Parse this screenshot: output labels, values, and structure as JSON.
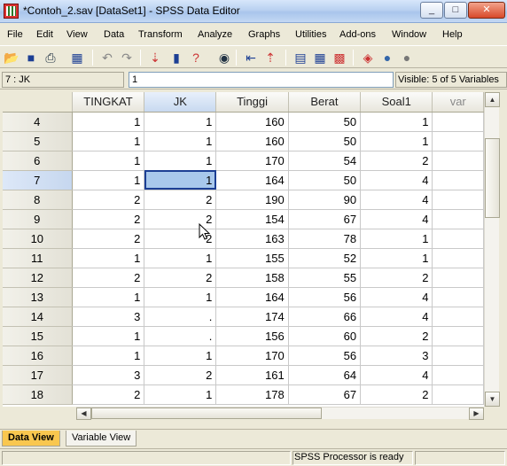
{
  "window": {
    "title": "*Contoh_2.sav [DataSet1] - SPSS Data Editor",
    "minimize": "_",
    "maximize": "□",
    "close": "✕"
  },
  "menu": [
    "File",
    "Edit",
    "View",
    "Data",
    "Transform",
    "Analyze",
    "Graphs",
    "Utilities",
    "Add-ons",
    "Window",
    "Help"
  ],
  "cellbar": {
    "ref": "7 : JK",
    "value": "1",
    "visible": "Visible: 5 of 5 Variables"
  },
  "grid": {
    "columns": [
      "TINGKAT",
      "JK",
      "Tinggi",
      "Berat",
      "Soal1",
      "var"
    ],
    "rows": [
      {
        "n": "4",
        "cells": [
          "1",
          "1",
          "160",
          "50",
          "1"
        ]
      },
      {
        "n": "5",
        "cells": [
          "1",
          "1",
          "160",
          "50",
          "1"
        ]
      },
      {
        "n": "6",
        "cells": [
          "1",
          "1",
          "170",
          "54",
          "2"
        ]
      },
      {
        "n": "7",
        "cells": [
          "1",
          "1",
          "164",
          "50",
          "4"
        ]
      },
      {
        "n": "8",
        "cells": [
          "2",
          "2",
          "190",
          "90",
          "4"
        ]
      },
      {
        "n": "9",
        "cells": [
          "2",
          "2",
          "154",
          "67",
          "4"
        ]
      },
      {
        "n": "10",
        "cells": [
          "2",
          "2",
          "163",
          "78",
          "1"
        ]
      },
      {
        "n": "11",
        "cells": [
          "1",
          "1",
          "155",
          "52",
          "1"
        ]
      },
      {
        "n": "12",
        "cells": [
          "2",
          "2",
          "158",
          "55",
          "2"
        ]
      },
      {
        "n": "13",
        "cells": [
          "1",
          "1",
          "164",
          "56",
          "4"
        ]
      },
      {
        "n": "14",
        "cells": [
          "3",
          ".",
          "174",
          "66",
          "4"
        ]
      },
      {
        "n": "15",
        "cells": [
          "1",
          ".",
          "156",
          "60",
          "2"
        ]
      },
      {
        "n": "16",
        "cells": [
          "1",
          "1",
          "170",
          "56",
          "3"
        ]
      },
      {
        "n": "17",
        "cells": [
          "3",
          "2",
          "161",
          "64",
          "4"
        ]
      },
      {
        "n": "18",
        "cells": [
          "2",
          "1",
          "178",
          "67",
          "2"
        ]
      }
    ]
  },
  "tabs": {
    "data_view": "Data View",
    "variable_view": "Variable View"
  },
  "status": {
    "text": "SPSS  Processor is ready"
  },
  "colors": {
    "active_cell": "#a8c8ec",
    "active_tab": "#f9c74f"
  }
}
